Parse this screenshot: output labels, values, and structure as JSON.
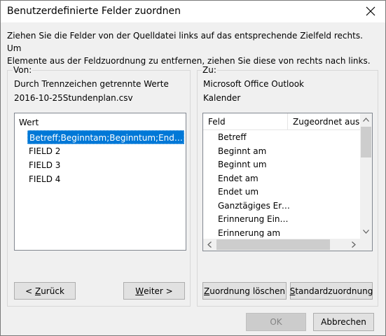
{
  "window": {
    "title": "Benutzerdefinierte Felder zuordnen",
    "close_glyph": "✕"
  },
  "instructions": "Ziehen Sie die Felder von der Quelldatei links auf das entsprechende Zielfeld rechts. Um\nElemente aus der Feldzuordnung zu entfernen, ziehen Sie diese von rechts nach links.",
  "source": {
    "heading": "Von:",
    "type": "Durch Trennzeichen getrennte Werte",
    "file": "2016-10-25Stundenplan.csv",
    "column_header": "Wert",
    "items": [
      "Betreff;Beginntam;Beginntum;Endetam;...",
      "FIELD 2",
      "FIELD 3",
      "FIELD 4"
    ],
    "selected_index": 0,
    "back_prefix": "< ",
    "back_mnemonic": "Z",
    "back_rest": "urück",
    "next_mnemonic": "W",
    "next_rest": "eiter >"
  },
  "target": {
    "heading": "Zu:",
    "app": "Microsoft Office Outlook",
    "folder": "Kalender",
    "col_field": "Feld",
    "col_mapped": "Zugeordnet aus",
    "fields": [
      "Betreff",
      "Beginnt am",
      "Beginnt um",
      "Endet am",
      "Endet um",
      "Ganztägiges Ere...",
      "Erinnerung Ein/...",
      "Erinnerung am"
    ],
    "clear_mnemonic": "Z",
    "clear_rest": "uordnung löschen",
    "default_mnemonic": "S",
    "default_rest": "tandardzuordnung"
  },
  "footer": {
    "ok_label": "OK",
    "cancel_label": "Abbrechen"
  },
  "icons": {
    "scroll_up": "chevron-up-icon",
    "scroll_down": "chevron-down-icon",
    "scroll_left": "chevron-left-icon",
    "scroll_right": "chevron-right-icon"
  },
  "colors": {
    "selection": "#0078d7",
    "focus_border": "#0078d7",
    "disabled_text": "#838383"
  }
}
